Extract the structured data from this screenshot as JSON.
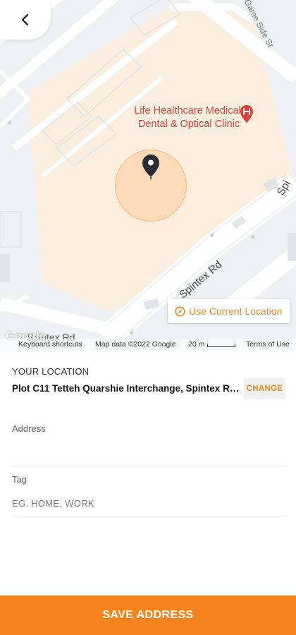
{
  "map": {
    "poi": {
      "label_line1": "Life Healthcare Medical,",
      "label_line2": "Dental & Optical Clinic",
      "icon": "hospital-icon"
    },
    "streets": {
      "game_side": "Game Side St",
      "spintex_road": "Spintex Rd",
      "spintex_partial": "Spi",
      "spintex_bottom": "Spintex Rd"
    },
    "use_current_location": "Use Current Location",
    "google_logo": "Google",
    "attribution": {
      "keyboard_shortcuts": "Keyboard shortcuts",
      "map_data": "Map data ©2022 Google",
      "scale": "20 m",
      "terms": "Terms of Use"
    },
    "pin_icon": "location-pin-icon",
    "back_icon": "chevron-left-icon"
  },
  "form": {
    "your_location_label": "YOUR LOCATION",
    "location_value": "Plot C11 Tetteh Quarshie Interchange, Spintex Rd,...",
    "change_label": "CHANGE",
    "address_label": "Address",
    "address_value": "",
    "tag_label": "Tag",
    "tag_placeholder": "EG. HOME, WORK"
  },
  "save_label": "SAVE ADDRESS",
  "colors": {
    "accent": "#f5841f",
    "poi": "#d6453e"
  }
}
